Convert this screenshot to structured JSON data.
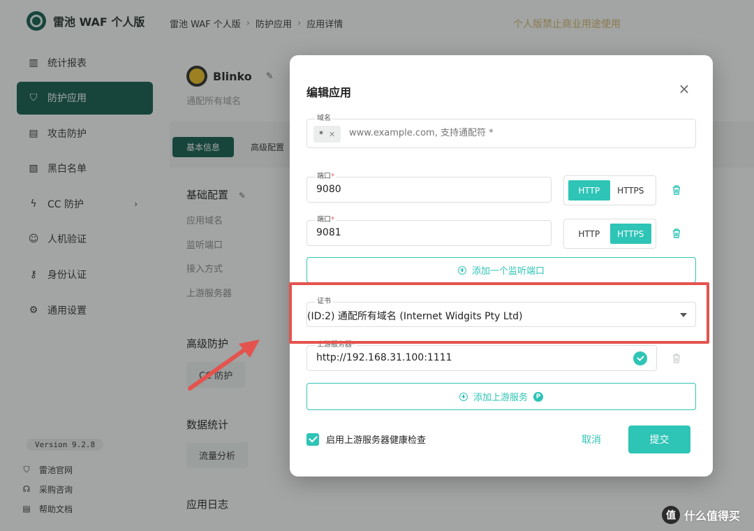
{
  "sidebar": {
    "logo_text": "雷池 WAF 个人版",
    "items": [
      {
        "label": "统计报表",
        "icon": "bar-chart-icon",
        "active": false
      },
      {
        "label": "防护应用",
        "icon": "shield-icon",
        "active": true
      },
      {
        "label": "攻击防护",
        "icon": "document-shield-icon",
        "active": false
      },
      {
        "label": "黑白名单",
        "icon": "list-icon",
        "active": false
      },
      {
        "label": "CC 防护",
        "icon": "bolt-icon",
        "active": false
      },
      {
        "label": "人机验证",
        "icon": "robot-icon",
        "active": false
      },
      {
        "label": "身份认证",
        "icon": "key-icon",
        "active": false
      },
      {
        "label": "通用设置",
        "icon": "gear-icon",
        "active": false
      }
    ],
    "version": "Version 9.2.8",
    "bottom_links": [
      {
        "label": "雷池官网",
        "icon": "shield-small-icon"
      },
      {
        "label": "采购咨询",
        "icon": "headset-icon"
      },
      {
        "label": "帮助文档",
        "icon": "doc-icon"
      }
    ]
  },
  "topbar": {
    "breadcrumb": [
      "雷池 WAF 个人版",
      "防护应用",
      "应用详情"
    ],
    "warning": "个人版禁止商业用途使用"
  },
  "app": {
    "name": "Blinko",
    "subtitle": "通配所有域名",
    "tabs": [
      "基本信息",
      "高级配置"
    ],
    "basic_config_title": "基础配置",
    "fields": [
      "应用域名",
      "监听端口",
      "接入方式",
      "上游服务器"
    ],
    "advanced_title": "高级防护",
    "cc_button": "CC 防护",
    "stats_title": "数据统计",
    "traffic_button": "流量分析",
    "logs_title": "应用日志"
  },
  "modal": {
    "title": "编辑应用",
    "domain_label": "域名",
    "domain_tag": "*",
    "domain_placeholder": "www.example.com, 支持通配符 *",
    "port_label": "端口",
    "ports": [
      {
        "value": "9080",
        "protocol": "HTTP"
      },
      {
        "value": "9081",
        "protocol": "HTTPS"
      }
    ],
    "protocol_http": "HTTP",
    "protocol_https": "HTTPS",
    "add_port": "添加一个监听端口",
    "cert_label": "证书",
    "cert_value": "(ID:2) 通配所有域名 (Internet Widgits Pty Ltd)",
    "upstream_label": "上游服务器",
    "upstream_value": "http://192.168.31.100:1111",
    "add_upstream": "添加上游服务",
    "health_check": "启用上游服务器健康检查",
    "cancel": "取消",
    "submit": "提交"
  },
  "watermark": {
    "logo": "值",
    "text": "什么值得买"
  },
  "colors": {
    "primary_dark": "#0e5a4d",
    "accent": "#2ec4b6",
    "highlight": "#e4534e",
    "warning_text": "#d2b46a"
  }
}
